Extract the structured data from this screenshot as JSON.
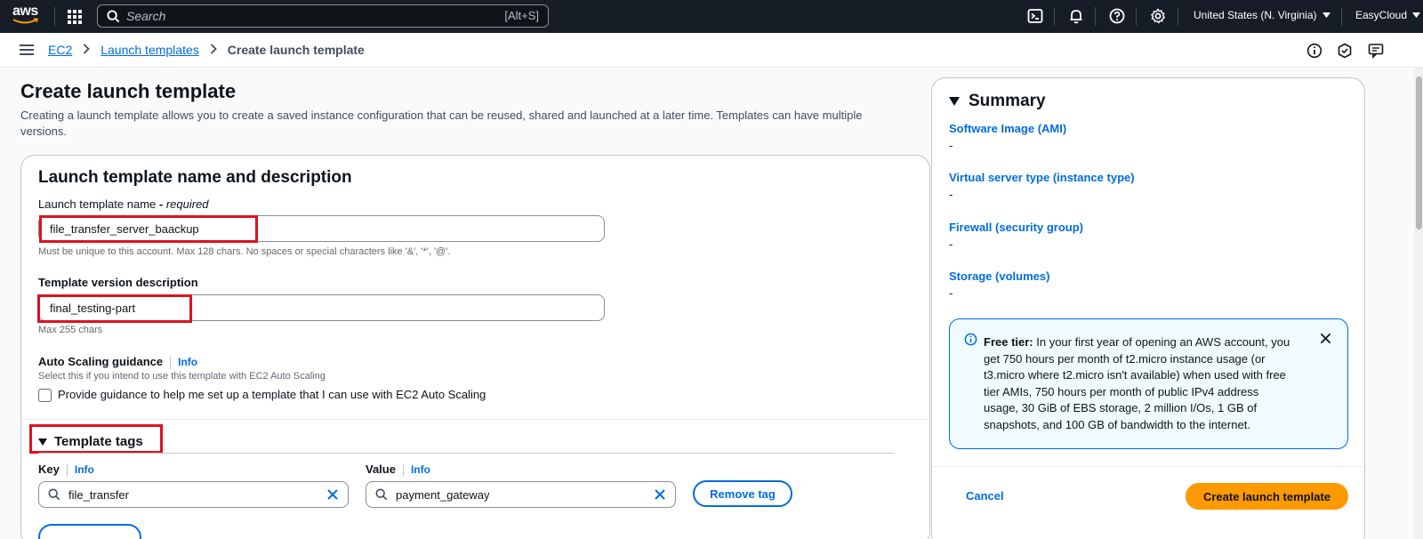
{
  "topnav": {
    "logo_text": "aws",
    "search_placeholder": "Search",
    "search_shortcut": "[Alt+S]",
    "region": "United States (N. Virginia)",
    "account": "EasyCloud",
    "bg_color": "#161d26"
  },
  "breadcrumb": {
    "items": [
      {
        "label": "EC2"
      },
      {
        "label": "Launch templates"
      }
    ],
    "current": "Create launch template"
  },
  "page": {
    "title": "Create launch template",
    "description": "Creating a launch template allows you to create a saved instance configuration that can be reused, shared and launched at a later time. Templates can have multiple versions."
  },
  "form": {
    "section_title": "Launch template name and description",
    "name_label": "Launch template name",
    "name_sep": " - ",
    "name_required": "required",
    "name_value": "file_transfer_server_baackup",
    "name_hint": "Must be unique to this account. Max 128 chars. No spaces or special characters like '&', '*', '@'.",
    "desc_label": "Template version description",
    "desc_value": "final_testing-part",
    "desc_hint": "Max 255 chars",
    "asg_label": "Auto Scaling guidance",
    "info": "Info",
    "asg_hint": "Select this if you intend to use this template with EC2 Auto Scaling",
    "asg_checkbox_label": "Provide guidance to help me set up a template that I can use with EC2 Auto Scaling",
    "asg_checked": false
  },
  "tags": {
    "title": "Template tags",
    "key_label": "Key",
    "value_label": "Value",
    "key_value": "file_transfer",
    "value_value": "payment_gateway",
    "remove_label": "Remove tag"
  },
  "summary": {
    "title": "Summary",
    "items": [
      {
        "label": "Software Image (AMI)",
        "value": "-"
      },
      {
        "label": "Virtual server type (instance type)",
        "value": "-"
      },
      {
        "label": "Firewall (security group)",
        "value": "-"
      },
      {
        "label": "Storage (volumes)",
        "value": "-"
      }
    ],
    "free_tier_bold": "Free tier:",
    "free_tier_text": " In your first year of opening an AWS account, you get 750 hours per month of t2.micro instance usage (or t3.micro where t2.micro isn't available) when used with free tier AMIs, 750 hours per month of public IPv4 address usage, 30 GiB of EBS storage, 2 million I/Os, 1 GB of snapshots, and 100 GB of bandwidth to the internet.",
    "cancel_label": "Cancel",
    "create_label": "Create launch template"
  },
  "colors": {
    "accent": "#006ce0",
    "primary_button": "#ff9900",
    "highlight": "#e01020"
  },
  "icons": [
    "aws-logo",
    "apps-grid-icon",
    "search-icon",
    "cloudshell-icon",
    "bell-icon",
    "help-icon",
    "gear-icon",
    "caret-down-icon",
    "menu-icon",
    "info-icon",
    "security-icon",
    "feedback-icon",
    "clear-icon",
    "close-icon"
  ]
}
